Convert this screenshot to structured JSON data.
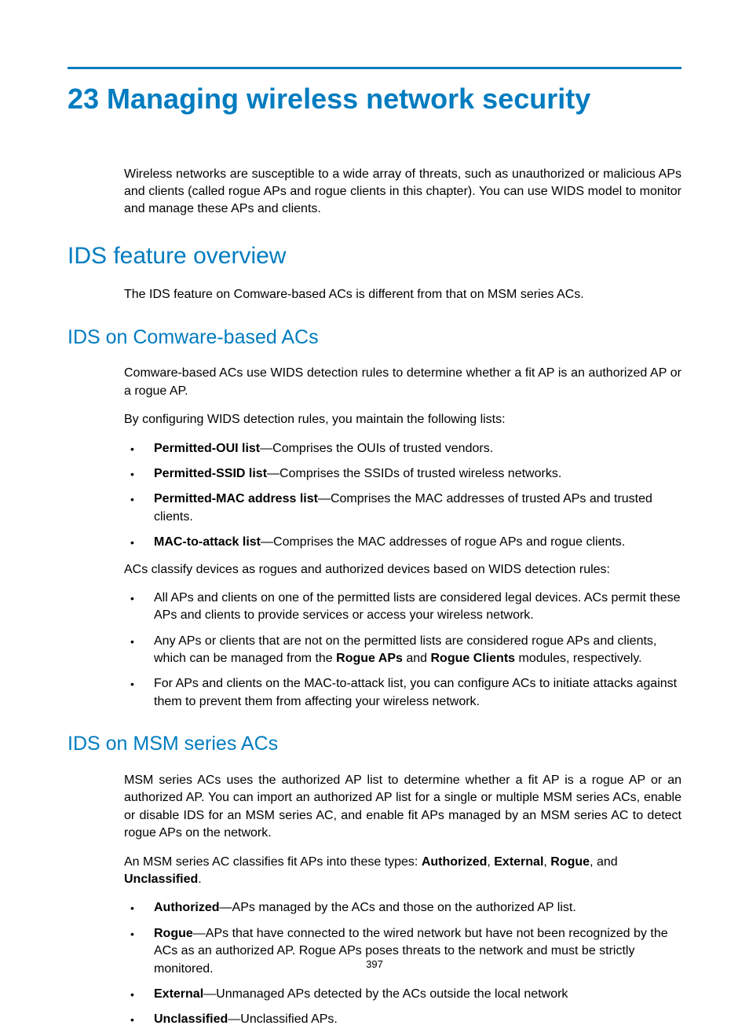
{
  "title": "23 Managing wireless network security",
  "intro": "Wireless networks are susceptible to a wide array of threats, such as unauthorized or malicious APs and clients (called rogue APs and rogue clients in this chapter). You can use WIDS model to monitor and manage these APs and clients.",
  "sec1": {
    "heading": "IDS feature overview",
    "p1": "The IDS feature on Comware-based ACs is different from that on MSM series ACs."
  },
  "sec2": {
    "heading": "IDS on Comware-based ACs",
    "p1": "Comware-based ACs use WIDS detection rules to determine whether a fit AP is an authorized AP or a rogue AP.",
    "p2": "By configuring WIDS detection rules, you maintain the following lists:",
    "list1": [
      {
        "b": "Permitted-OUI list",
        "t": "—Comprises the OUIs of trusted vendors."
      },
      {
        "b": "Permitted-SSID list",
        "t": "—Comprises the SSIDs of trusted wireless networks."
      },
      {
        "b": "Permitted-MAC address list",
        "t": "—Comprises the MAC addresses of trusted APs and trusted clients."
      },
      {
        "b": "MAC-to-attack list",
        "t": "—Comprises the MAC addresses of rogue APs and rogue clients."
      }
    ],
    "p3": "ACs classify devices as rogues and authorized devices based on WIDS detection rules:",
    "list2_0": "All APs and clients on one of the permitted lists are considered legal devices. ACs permit these APs and clients to provide services or access your wireless network.",
    "list2_1_a": "Any APs or clients that are not on the permitted lists are considered rogue APs and clients, which can be managed from the ",
    "list2_1_b1": "Rogue APs",
    "list2_1_mid": " and ",
    "list2_1_b2": "Rogue Clients",
    "list2_1_c": " modules, respectively.",
    "list2_2": "For APs and clients on the MAC-to-attack list, you can configure ACs to initiate attacks against them to prevent them from affecting your wireless network."
  },
  "sec3": {
    "heading": "IDS on MSM series ACs",
    "p1": "MSM series ACs uses the authorized AP list to determine whether a fit AP is a rogue AP or an authorized AP. You can import an authorized AP list for a single or multiple MSM series ACs, enable or disable IDS for an MSM series AC, and enable fit APs managed by an MSM series AC to detect rogue APs on the network.",
    "p2_a": "An MSM series AC classifies fit APs into these types: ",
    "p2_b1": "Authorized",
    "p2_s1": ", ",
    "p2_b2": "External",
    "p2_s2": ", ",
    "p2_b3": "Rogue",
    "p2_s3": ", and ",
    "p2_b4": "Unclassified",
    "p2_s4": ".",
    "list1": [
      {
        "b": "Authorized",
        "t": "—APs managed by the ACs and those on the authorized AP list."
      },
      {
        "b": "Rogue",
        "t": "—APs that have connected to the wired network but have not been recognized by the ACs as an authorized AP. Rogue APs poses threats to the network and must be strictly monitored."
      },
      {
        "b": "External",
        "t": "—Unmanaged APs detected by the ACs outside the local network"
      },
      {
        "b": "Unclassified",
        "t": "—Unclassified APs."
      }
    ]
  },
  "pagenum": "397"
}
